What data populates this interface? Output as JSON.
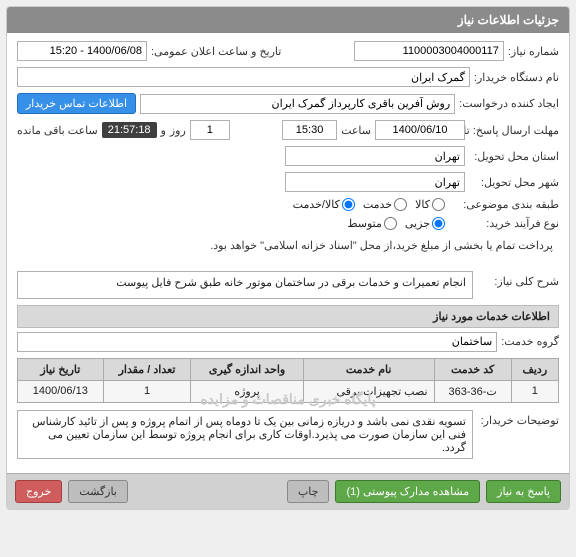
{
  "panel_title": "جزئیات اطلاعات نیاز",
  "fields": {
    "need_no": {
      "label": "شماره نیاز:",
      "value": "1100003004000117"
    },
    "announce": {
      "label": "تاریخ و ساعت اعلان عمومی:",
      "value": "1400/06/08 - 15:20"
    },
    "buyer_org": {
      "label": "نام دستگاه خریدار:",
      "value": "گمرک ایران"
    },
    "requester": {
      "label": "ایجاد کننده درخواست:",
      "value": "روش آفرین باقری کارپرداز گمرک ایران"
    },
    "contact_btn": "اطلاعات تماس خریدار",
    "deadline": {
      "label": "مهلت ارسال پاسخ: تا تاریخ:",
      "date": "1400/06/10",
      "saat": "ساعت",
      "time": "15:30",
      "rooz": "روز",
      "days": "1",
      "and": "و",
      "countdown": "21:57:18",
      "remain": "ساعت باقی مانده"
    },
    "deliver_province": {
      "label": "استان محل تحویل:",
      "value": "تهران"
    },
    "deliver_city": {
      "label": "شهر محل تحویل:",
      "value": "تهران"
    },
    "subject_cat": {
      "label": "طبقه بندی موضوعی:",
      "opts": [
        "کالا",
        "خدمت",
        "کالا/خدمت"
      ],
      "selected": 2
    },
    "buy_process": {
      "label": "نوع فرآیند خرید:",
      "opts": [
        "جزیی",
        "متوسط"
      ],
      "selected": 0
    },
    "pay_note": "پرداخت تمام یا بخشی از مبلغ خرید،از محل \"اسناد خزانه اسلامی\" خواهد بود."
  },
  "main_desc": {
    "label": "شرح کلی نیاز:",
    "value": "انجام تعمیرات و خدمات برقی در ساختمان موتور خانه طبق شرح فایل پیوست"
  },
  "services_header": "اطلاعات خدمات مورد نیاز",
  "service_group": {
    "label": "گروه خدمت:",
    "value": "ساختمان"
  },
  "table": {
    "headers": [
      "ردیف",
      "کد خدمت",
      "نام خدمت",
      "واحد اندازه گیری",
      "تعداد / مقدار",
      "تاریخ نیاز"
    ],
    "rows": [
      [
        "1",
        "ت-36-363",
        "نصب تجهیزات برقی",
        "پروژه",
        "1",
        "1400/06/13"
      ]
    ]
  },
  "watermark": "پایگاه خبری مناقصات و مزایده",
  "buyer_notes": {
    "label": "توضیحات خریدار:",
    "value": "تسویه نقدی نمی باشد و دریازه زمانی بین یک تا دوماه پس از اتمام پروژه و پس از تائید کارشناس فنی این سازمان صورت می پذیرد.اوقات کاری برای انجام پروژه توسط این سازمان تعیین می گردد."
  },
  "footer": {
    "respond": "پاسخ به نیاز",
    "attachments": "مشاهده مدارک پیوستی (1)",
    "print": "چاپ",
    "back": "بازگشت",
    "exit": "خروج"
  }
}
